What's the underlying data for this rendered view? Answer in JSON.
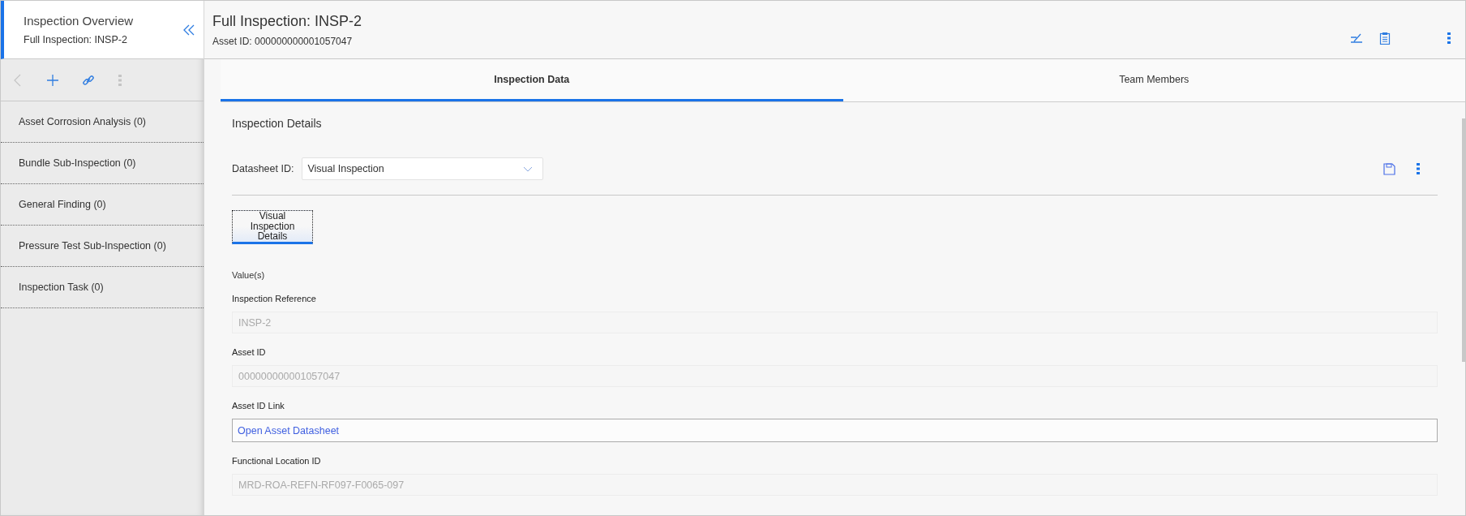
{
  "sidebar": {
    "title": "Inspection Overview",
    "subtitle": "Full Inspection: INSP-2",
    "toolbar": [
      {
        "kind": "back",
        "disabled": true
      },
      {
        "kind": "add",
        "disabled": false
      },
      {
        "kind": "link",
        "disabled": false
      },
      {
        "kind": "more",
        "disabled": true
      }
    ],
    "items": [
      {
        "label": "Asset Corrosion Analysis (0)"
      },
      {
        "label": "Bundle Sub-Inspection (0)"
      },
      {
        "label": "General Finding (0)"
      },
      {
        "label": "Pressure Test Sub-Inspection (0)"
      },
      {
        "label": "Inspection Task (0)"
      }
    ]
  },
  "header": {
    "title": "Full Inspection: INSP-2",
    "subtitle": "Asset ID: 000000000001057047"
  },
  "tabs": [
    {
      "label": "Inspection Data",
      "selected": true
    },
    {
      "label": "Team Members",
      "selected": false
    }
  ],
  "section": {
    "title": "Inspection Details",
    "datasheet_label": "Datasheet ID:",
    "datasheet_value": "Visual Inspection",
    "subtabs": [
      {
        "label": "Visual Inspection Details",
        "selected": true
      }
    ],
    "values_label": "Value(s)",
    "fields": [
      {
        "label": "Inspection Reference",
        "value": "INSP-2",
        "kind": "text",
        "disabled": true
      },
      {
        "label": "Asset ID",
        "value": "000000000001057047",
        "kind": "text",
        "disabled": true
      },
      {
        "label": "Asset ID Link",
        "value": "Open Asset Datasheet",
        "kind": "link",
        "disabled": false
      },
      {
        "label": "Functional Location ID",
        "value": "MRD-ROA-REFN-RF097-F0065-097",
        "kind": "text",
        "disabled": true
      }
    ]
  }
}
